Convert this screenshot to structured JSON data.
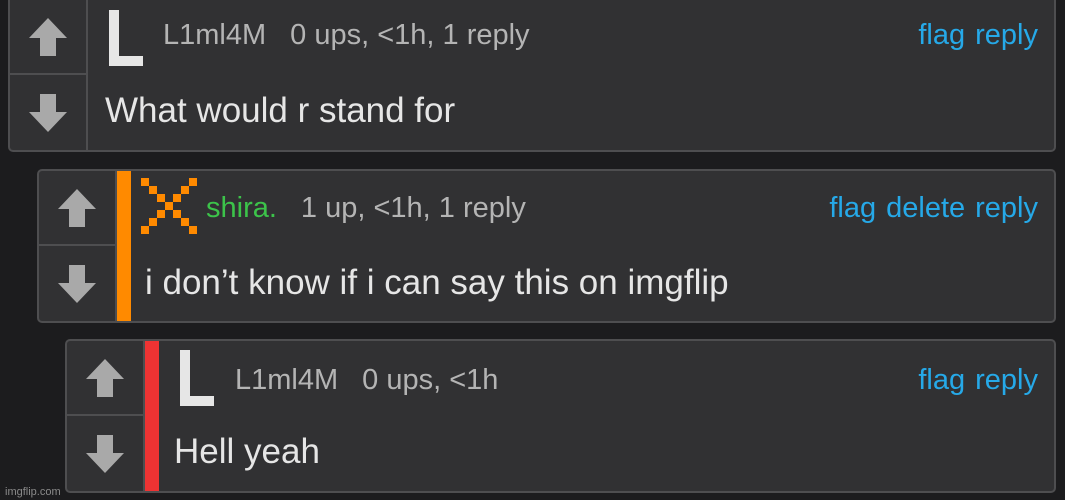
{
  "comments": [
    {
      "username": "L1ml4M",
      "meta": "0 ups, <1h, 1 reply",
      "actions": [
        "flag",
        "reply"
      ],
      "text": "What would r stand for"
    },
    {
      "username": "shira.",
      "meta": "1 up, <1h, 1 reply",
      "actions": [
        "flag",
        "delete",
        "reply"
      ],
      "text": "i don’t know if i can say this on imgflip"
    },
    {
      "username": "L1ml4M",
      "meta": "0 ups, <1h",
      "actions": [
        "flag",
        "reply"
      ],
      "text": "Hell yeah"
    }
  ],
  "watermark": "imgflip.com",
  "colors": {
    "background": "#1c1c1e",
    "panel": "#313133",
    "link": "#26a9e8",
    "username_green": "#3cc34a",
    "thread_orange": "#ff8a00",
    "thread_red": "#ee3333"
  },
  "icons": {
    "upvote": "up-arrow-icon",
    "downvote": "down-arrow-icon",
    "avatar_L": "letter-L-avatar",
    "avatar_X": "pixel-x-avatar"
  }
}
